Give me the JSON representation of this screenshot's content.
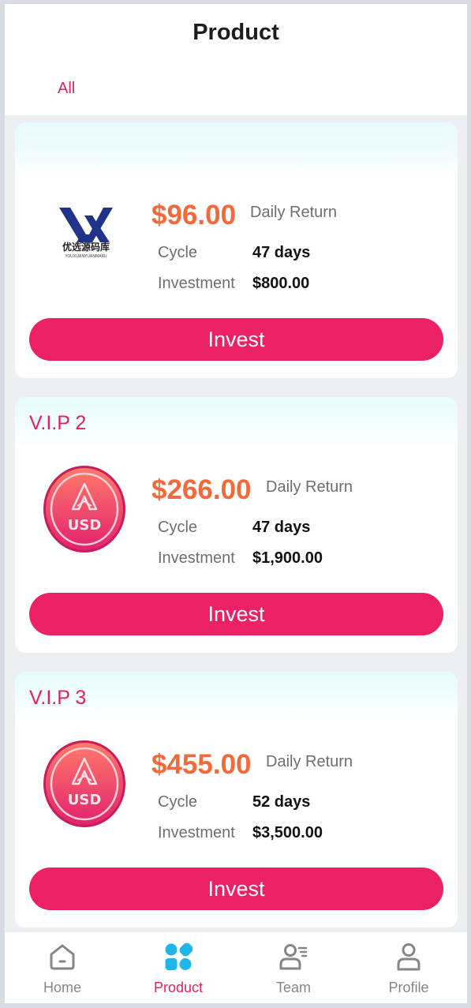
{
  "header": {
    "title": "Product",
    "tabs": [
      {
        "label": "All",
        "active": true
      }
    ]
  },
  "products": [
    {
      "name": "",
      "logo": {
        "icon": "yx-logo",
        "brand_text": "优选源码库",
        "brand_subtext": "YOUXUANYUANMAKU",
        "color": "#20338a"
      },
      "daily_return_value": "$96.00",
      "daily_return_label": "Daily Return",
      "cycle_label": "Cycle",
      "cycle_value": "47 days",
      "investment_label": "Investment",
      "investment_value": "$800.00",
      "button_label": "Invest"
    },
    {
      "name": "V.I.P 2",
      "logo": {
        "icon": "usd-coin-icon",
        "coin_text": "USD"
      },
      "daily_return_value": "$266.00",
      "daily_return_label": "Daily Return",
      "cycle_label": "Cycle",
      "cycle_value": "47 days",
      "investment_label": "Investment",
      "investment_value": "$1,900.00",
      "button_label": "Invest"
    },
    {
      "name": "V.I.P 3",
      "logo": {
        "icon": "usd-coin-icon",
        "coin_text": "USD"
      },
      "daily_return_value": "$455.00",
      "daily_return_label": "Daily Return",
      "cycle_label": "Cycle",
      "cycle_value": "52 days",
      "investment_label": "Investment",
      "investment_value": "$3,500.00",
      "button_label": "Invest"
    }
  ],
  "bottom_nav": [
    {
      "label": "Home",
      "icon": "home-icon",
      "active": false
    },
    {
      "label": "Product",
      "icon": "product-grid-icon",
      "active": true
    },
    {
      "label": "Team",
      "icon": "team-icon",
      "active": false
    },
    {
      "label": "Profile",
      "icon": "profile-icon",
      "active": false
    }
  ],
  "colors": {
    "accent": "#eb2065",
    "accent_text": "#e0225f",
    "price": "#f36a3a",
    "nav_active_icon": "#1fb6e9",
    "nav_inactive": "#85858b",
    "page_bg": "#eeeff3"
  }
}
